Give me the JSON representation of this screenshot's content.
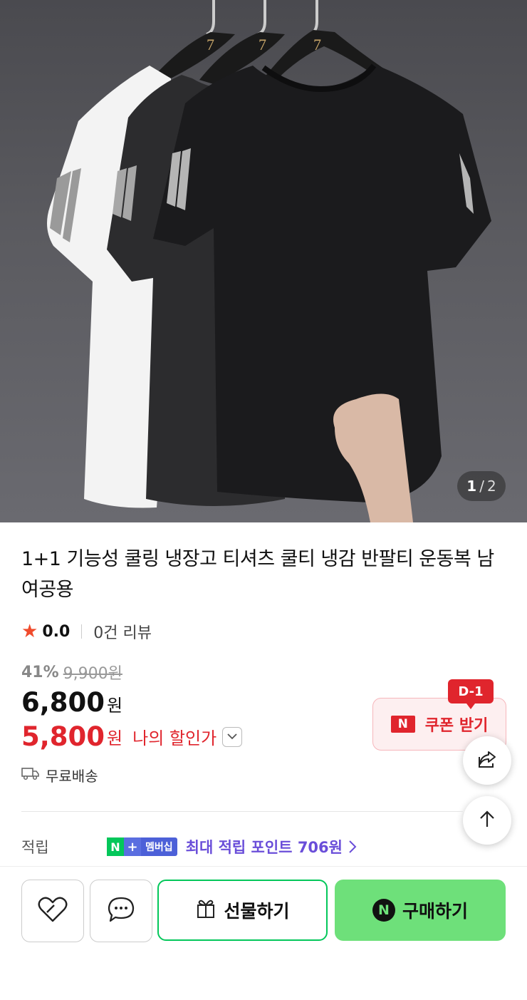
{
  "image": {
    "counter_current": "1",
    "counter_separator": "/",
    "counter_total": "2",
    "hanger_logo": "7"
  },
  "product": {
    "title": "1+1 기능성 쿨링 냉장고 티셔츠 쿨티 냉감 반팔티 운동복 남여공용",
    "rating": "0.0",
    "review_count": "0건 리뷰",
    "discount_rate": "41%",
    "original_price": "9,900원",
    "price": "6,800",
    "price_unit": "원",
    "my_price": "5,800",
    "my_price_unit": "원",
    "my_price_label": "나의 할인가",
    "shipping": "무료배송"
  },
  "coupon": {
    "badge": "D-1",
    "n_logo": "N",
    "label": "쿠폰 받기"
  },
  "points": {
    "label": "적립",
    "badge_n": "N",
    "badge_plus": "+",
    "badge_membership": "멤버십",
    "text": "최대 적립 포인트 706원"
  },
  "actions": {
    "gift_label": "선물하기",
    "buy_label": "구매하기",
    "buy_n": "N"
  },
  "colors": {
    "accent_red": "#e0252d",
    "naver_green": "#03c75a",
    "buy_green": "#6ee07a",
    "membership_purple": "#6a4ed9"
  },
  "icons": [
    "star-icon",
    "chevron-down-icon",
    "truck-icon",
    "share-icon",
    "arrow-up-icon",
    "heart-icon",
    "chat-icon",
    "gift-icon",
    "chevron-right-icon"
  ]
}
